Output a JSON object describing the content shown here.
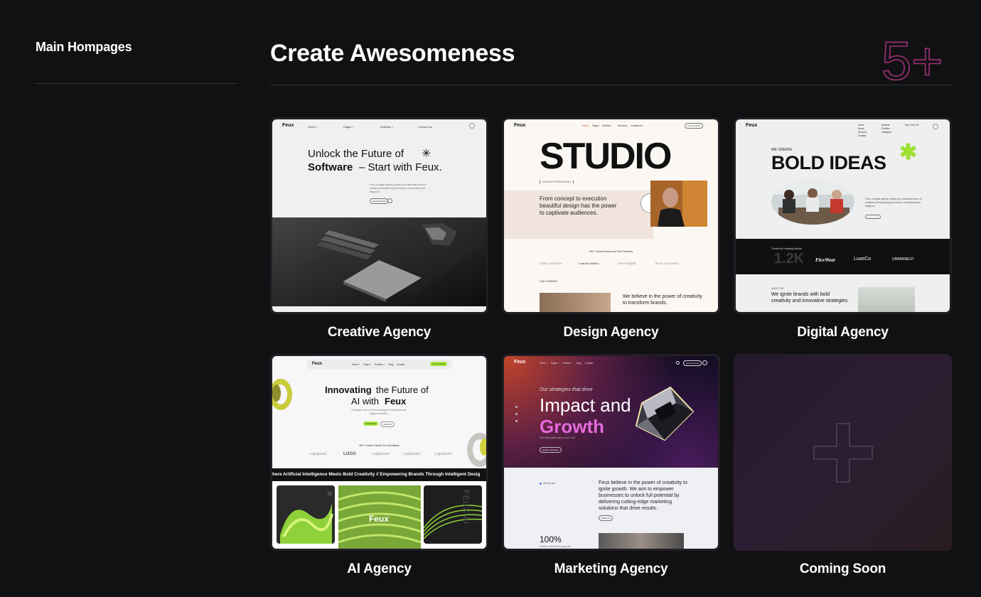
{
  "sidebar": {
    "title": "Main Hompages"
  },
  "header": {
    "title": "Create Awesomeness",
    "badge": "5+",
    "badge_color": "#a0307a"
  },
  "cards": [
    {
      "label": "Creative Agency",
      "preview": {
        "logo": "Feux",
        "nav": [
          "Home +",
          "Pages +",
          "Portfolio +",
          "Contact Us"
        ],
        "headline_1": "Unlock the Future of",
        "headline_2a": "Software",
        "headline_2b": "– Start with Feux.",
        "blurb": "Feux, a digital agency crafted by a dedicated team of creatives championing the essence of simplicity and elegance.",
        "cta": "Let's Connect"
      }
    },
    {
      "label": "Design Agency",
      "preview": {
        "logo": "Feux",
        "nav": [
          "Home",
          "Pages",
          "Portfolio",
          "Services",
          "Contact Us"
        ],
        "cta": "Let's Connect",
        "headline": "STUDIO",
        "tag": "DESIGN FOR BRANDING",
        "sub": "From concept to execution beautiful design has the power to captivate audiences.",
        "clients_heading": "200+ Trusted Brands and Over Portfolios",
        "clients": [
          "Clarity Ventures",
          "Lumina Studios",
          "Verve Digital",
          "Nova Cosmetics"
        ],
        "about_tag": "OUR COMPANY",
        "about": "We believe in the power of creativity to transform brands."
      }
    },
    {
      "label": "Digital Agency",
      "preview": {
        "logo": "Feux",
        "nav": [
          "Home",
          "About",
          "Services",
          "Contact",
          "Website",
          "Portfolio",
          "Instagram"
        ],
        "location": "New York, NY",
        "kicker": "WE CREATE",
        "headline": "BOLD IDEAS",
        "blurb": "Feux, a digital agency crafted by a dedicated team of creatives championing the essence of simplicity and elegance.",
        "trusted": "Trusted by Leading Brands",
        "stat": "1.2K",
        "brands": [
          "FlexWear",
          "LuxeCo",
          "URBANNEST"
        ],
        "section_tag": "ABOUT US",
        "about": "We ignite brands with bold creativity and innovative strategies."
      }
    },
    {
      "label": "AI Agency",
      "preview": {
        "logo": "Feux",
        "nav": [
          "Home +",
          "Pages +",
          "Portfolio +",
          "Blog",
          "Contact"
        ],
        "cta": "Let's Connect",
        "headline_1a": "Innovating",
        "headline_1b": "the Future of",
        "headline_2a": "AI with",
        "headline_2b": "Feux",
        "sub": "Focusing on the new AI technology for businesses and digital innovations",
        "btn_1": "Get Started",
        "btn_2": "About Us",
        "clients_heading": "300+ Trusted Clients Over Worldwide",
        "clients": [
          "Logoipsum",
          "LOGO",
          "Logoipsum",
          "Logoipsum",
          "Logoipsum"
        ],
        "ticker": "here Artificial Intelligence Meets Bold Creativity  //  Empowering Brands Through Intelligent Desig",
        "tile_text": "Feux",
        "tile_vertical": "FEUX AI"
      }
    },
    {
      "label": "Marketing Agency",
      "preview": {
        "logo": "Feux",
        "nav": [
          "Home +",
          "Pages +",
          "Portfolio +",
          "Blog",
          "Contact"
        ],
        "cta": "Let's Connect",
        "kicker": "Our strategies that drive",
        "headline_1": "Impact and",
        "headline_2": "Growth",
        "sub": "Marketing digital agency since 2001",
        "btn": "Explore Services",
        "who": "Who we are",
        "about": "Feux believe in the power of creativity to ignite growth. We aim to empower businesses to unlock full potential by delivering cutting-edge marketing solutions that drive results.",
        "about_btn": "About Us",
        "stat": "100%",
        "stat_label": "Services satisfaction guarantee"
      }
    },
    {
      "label": "Coming Soon"
    }
  ]
}
